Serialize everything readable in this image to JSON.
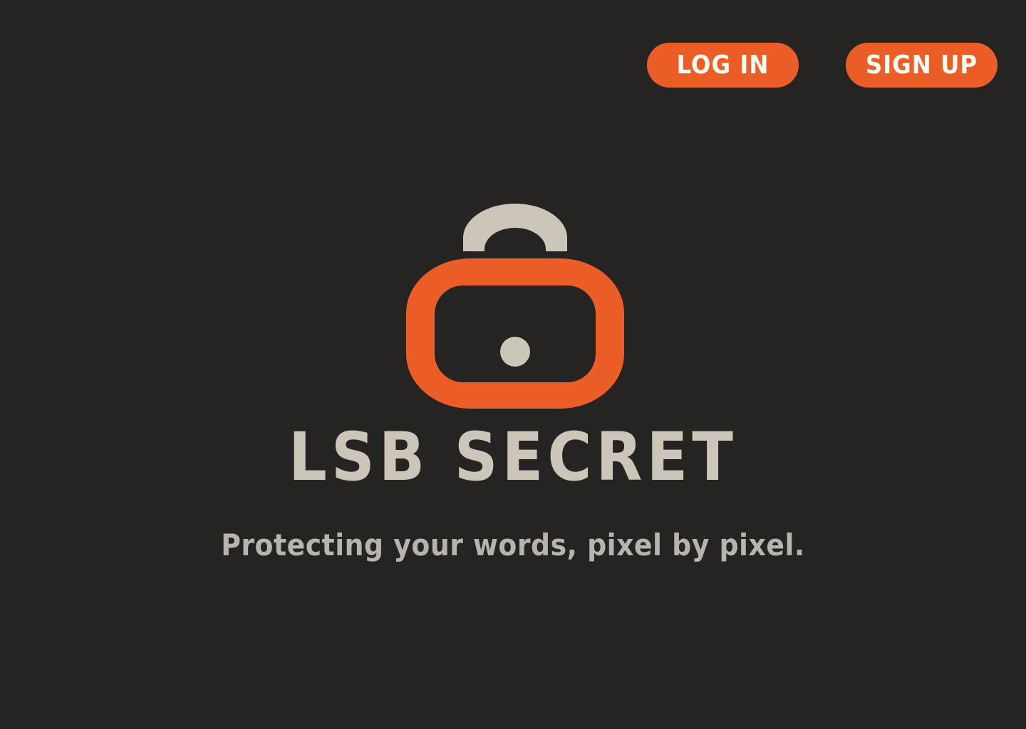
{
  "header": {
    "login_label": "LOG IN",
    "signup_label": "SIGN UP"
  },
  "hero": {
    "logo_icon": "padlock-icon",
    "title": "LSB SECRET",
    "tagline": "Protecting your words, pixel by pixel."
  },
  "colors": {
    "background": "#252423",
    "accent": "#EB5E28",
    "light": "#CCC5B9",
    "button_text": "#FFFCF2"
  }
}
